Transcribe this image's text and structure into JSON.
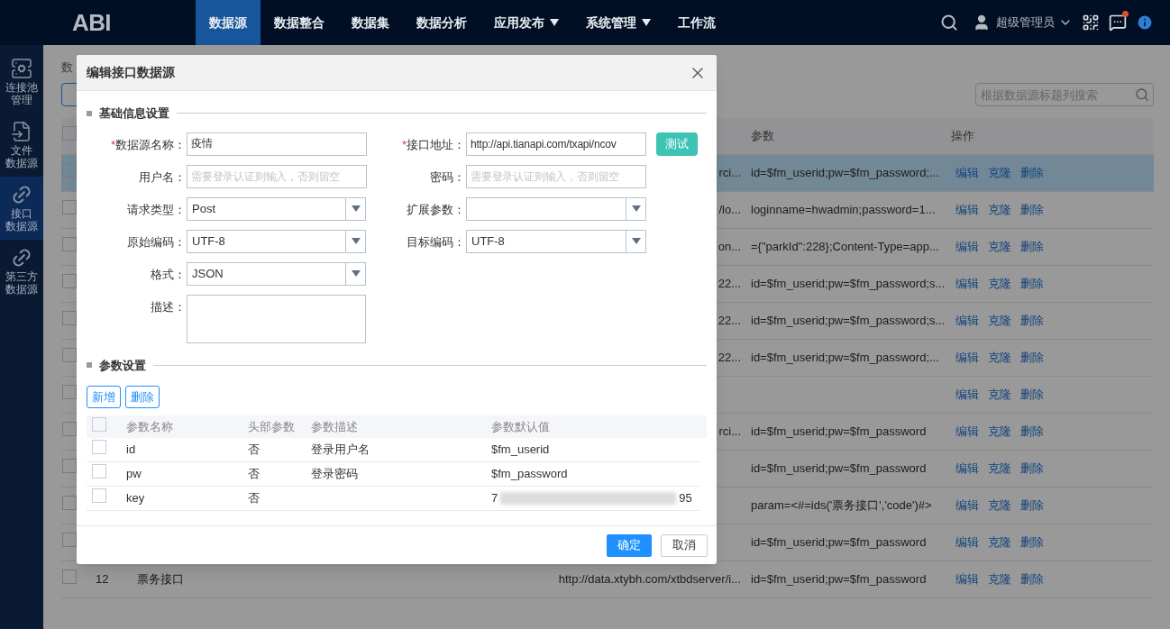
{
  "topbar": {
    "logo": "ABI",
    "nav": [
      {
        "label": "数据源",
        "selected": true,
        "caret": false
      },
      {
        "label": "数据整合",
        "selected": false,
        "caret": false
      },
      {
        "label": "数据集",
        "selected": false,
        "caret": false
      },
      {
        "label": "数据分析",
        "selected": false,
        "caret": false
      },
      {
        "label": "应用发布",
        "selected": false,
        "caret": true
      },
      {
        "label": "系统管理",
        "selected": false,
        "caret": true
      },
      {
        "label": "工作流",
        "selected": false,
        "caret": false
      }
    ],
    "user": "超级管理员",
    "has_notification": true
  },
  "sidebar": {
    "items": [
      {
        "label_lines": [
          "连接池",
          "管理"
        ],
        "kind": "server",
        "selected": false
      },
      {
        "label_lines": [
          "文件",
          "数据源"
        ],
        "kind": "file",
        "selected": false
      },
      {
        "label_lines": [
          "接口",
          "数据源"
        ],
        "kind": "link",
        "selected": true
      },
      {
        "label_lines": [
          "第三方",
          "数据源"
        ],
        "kind": "link",
        "selected": false
      }
    ]
  },
  "page": {
    "breadcrumb": "数",
    "search": {
      "placeholder": "根据数据源标题列搜索"
    },
    "table": {
      "all_checked": false,
      "columns": [
        {
          "label": "参数"
        },
        {
          "label": "操作"
        }
      ],
      "rows": [
        {
          "selected": true,
          "checked": false,
          "url": "rci...",
          "params": "id=$fm_userid;pw=$fm_password;...",
          "actions": [
            "编辑",
            "克隆",
            "删除"
          ]
        },
        {
          "selected": false,
          "checked": false,
          "url": "/lo...",
          "params": "loginname=hwadmin;password=1...",
          "actions": [
            "编辑",
            "克隆",
            "删除"
          ]
        },
        {
          "selected": false,
          "checked": false,
          "url": "on...",
          "params": "={\"parkId\":228};Content-Type=app...",
          "actions": [
            "编辑",
            "克隆",
            "删除"
          ]
        },
        {
          "selected": false,
          "checked": false,
          "url": "22...",
          "params": "id=$fm_userid;pw=$fm_password;s...",
          "actions": [
            "编辑",
            "克隆",
            "删除"
          ]
        },
        {
          "selected": false,
          "checked": false,
          "url": "22...",
          "params": "id=$fm_userid;pw=$fm_password;s...",
          "actions": [
            "编辑",
            "克隆",
            "删除"
          ]
        },
        {
          "selected": false,
          "checked": false,
          "url": "22...",
          "params": "id=$fm_userid;pw=$fm_password;...",
          "actions": [
            "编辑",
            "克隆",
            "删除"
          ]
        },
        {
          "selected": false,
          "checked": false,
          "actions": [
            "编辑",
            "克隆",
            "删除"
          ]
        },
        {
          "selected": false,
          "checked": false,
          "url": "rci...",
          "params": "id=$fm_userid;pw=$fm_password",
          "actions": [
            "编辑",
            "克隆",
            "删除"
          ]
        },
        {
          "selected": false,
          "checked": false,
          "params": "id=$fm_userid;pw=$fm_password",
          "actions": [
            "编辑",
            "克隆",
            "删除"
          ]
        },
        {
          "selected": false,
          "checked": false,
          "params": "param=<#=ids('票务接口','code')#>",
          "actions": [
            "编辑",
            "克隆",
            "删除"
          ]
        },
        {
          "selected": false,
          "checked": false,
          "params": "id=$fm_userid;pw=$fm_password",
          "actions": [
            "编辑",
            "克隆",
            "删除"
          ]
        },
        {
          "selected": false,
          "checked": false,
          "number": "12",
          "name": "票务接口",
          "url": "http://data.xtybh.com/xtbdserver/i...",
          "params": "id=$fm_userid;pw=$fm_password",
          "actions": [
            "编辑",
            "克隆",
            "删除"
          ]
        }
      ]
    }
  },
  "dialog": {
    "title": "编辑接口数据源",
    "basic_section": "基础信息设置",
    "form_rows": [
      [
        {
          "kind": "text",
          "required_mark": "*",
          "label": "数据源名称：",
          "value": "疫情"
        },
        {
          "kind": "text",
          "required_mark": "*",
          "label": "接口地址：",
          "value": "http://api.tianapi.com/txapi/ncov",
          "button": "测试"
        }
      ],
      [
        {
          "kind": "text",
          "label": "用户名：",
          "placeholder": "需要登录认证则输入，否则留空"
        },
        {
          "kind": "text",
          "label": "密码：",
          "placeholder": "需要登录认证则输入，否则留空"
        }
      ],
      [
        {
          "kind": "select",
          "label": "请求类型：",
          "value": "Post"
        },
        {
          "kind": "select",
          "label": "扩展参数："
        }
      ],
      [
        {
          "kind": "select",
          "label": "原始编码：",
          "value": "UTF-8"
        },
        {
          "kind": "select",
          "label": "目标编码：",
          "value": "UTF-8"
        }
      ],
      [
        {
          "kind": "select",
          "label": "格式：",
          "value": "JSON"
        }
      ],
      [
        {
          "kind": "textarea",
          "label": "描述："
        }
      ]
    ],
    "param_section": "参数设置",
    "param_buttons": [
      "新增",
      "删除"
    ],
    "param_table": {
      "all_checked": false,
      "columns": [
        "参数名称",
        "头部参数",
        "参数描述",
        "参数默认值"
      ],
      "rows": [
        {
          "checked": false,
          "name": "id",
          "header": "否",
          "description": "登录用户名",
          "default": "$fm_userid"
        },
        {
          "checked": false,
          "name": "pw",
          "header": "否",
          "description": "登录密码",
          "default": "$fm_password"
        },
        {
          "checked": false,
          "name": "key",
          "header": "否",
          "default": "7",
          "default_end": "95",
          "redacted": true
        }
      ]
    },
    "ok": "确定",
    "cancel": "取消"
  }
}
